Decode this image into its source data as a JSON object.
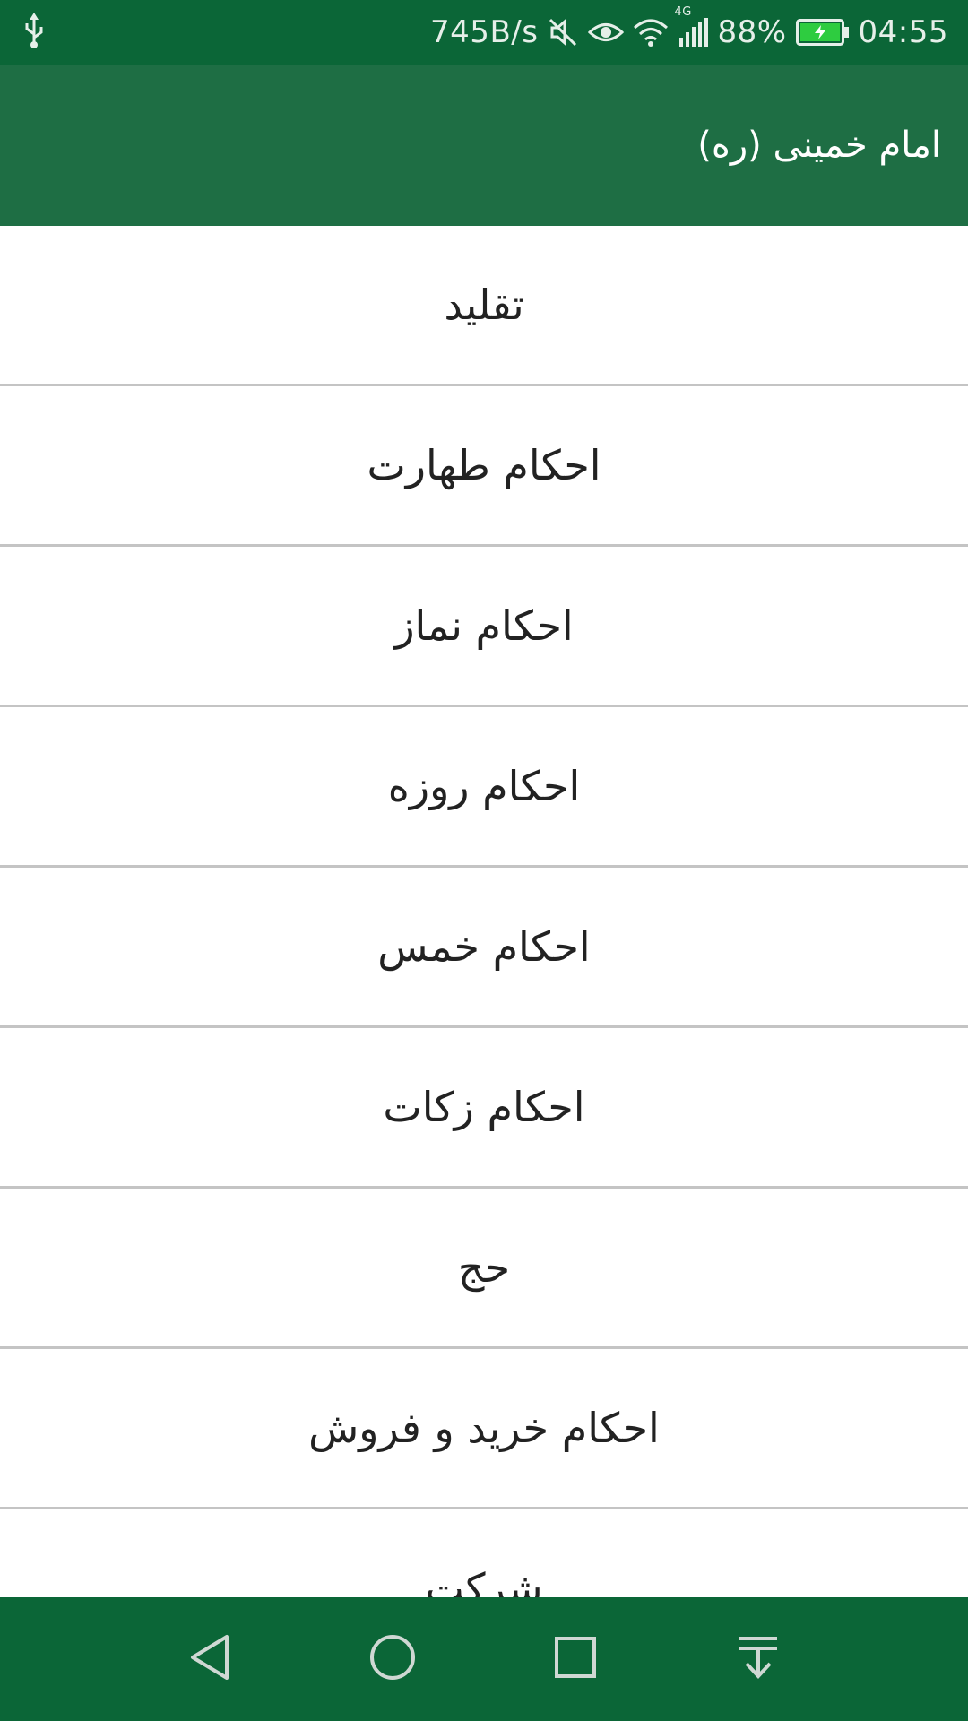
{
  "status_bar": {
    "net_speed": "745B/s",
    "network_type": "4G",
    "battery": "88%",
    "time": "04:55",
    "icons": [
      "usb-icon",
      "mute-icon",
      "eye-icon",
      "wifi-icon",
      "signal-icon",
      "battery-icon"
    ]
  },
  "app_bar": {
    "title": "امام خمینی (ره)"
  },
  "list": {
    "items": [
      {
        "label": "تقلید"
      },
      {
        "label": "احکام طهارت"
      },
      {
        "label": "احکام نماز"
      },
      {
        "label": "احکام روزه"
      },
      {
        "label": "احکام خمس"
      },
      {
        "label": "احکام زکات"
      },
      {
        "label": "حج"
      },
      {
        "label": "احکام خرید و فروش"
      },
      {
        "label": "شرکت"
      }
    ]
  },
  "nav_bar": {
    "icons": [
      "back-icon",
      "home-icon",
      "recents-icon",
      "notification-pulldown-icon"
    ]
  },
  "colors": {
    "status_bar": "#0b6637",
    "app_bar": "#1e6e44",
    "divider": "#c4c4c4",
    "list_text": "#222222",
    "battery_fill": "#2ecc40"
  }
}
